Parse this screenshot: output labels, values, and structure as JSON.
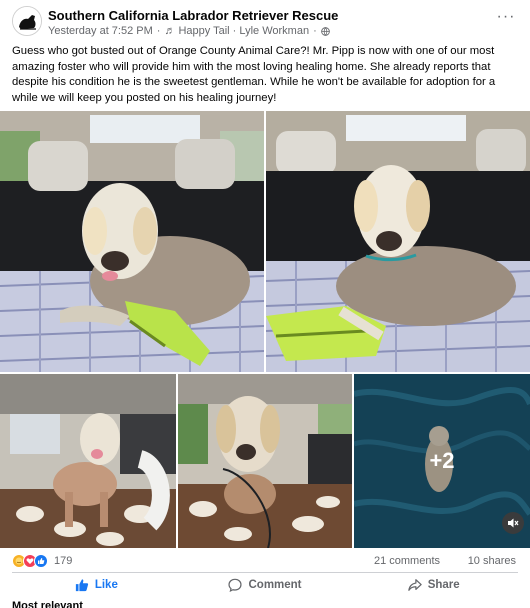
{
  "post": {
    "page_name": "Southern California Labrador Retriever Rescue",
    "time": "Yesterday at 7:52 PM",
    "music": "Happy Tail · Lyle Workman",
    "more_label": "···",
    "text": "Guess who got busted out of Orange County Animal Care?! Mr. Pipp is now with one of our most amazing foster who will provide him with the most loving healing home. She already reports that despite his condition he is the sweetest gentleman. While he won't be available for adoption for a while we will keep you posted on his healing journey!"
  },
  "photos": {
    "extra_count": "+2"
  },
  "engagement": {
    "reaction_count": "179",
    "comments": "21 comments",
    "shares": "10 shares"
  },
  "actions": {
    "like": "Like",
    "comment": "Comment",
    "share": "Share"
  },
  "comments_sort": "Most relevant",
  "colors": {
    "accent": "#1877f2",
    "secondary_text": "#65676b"
  }
}
